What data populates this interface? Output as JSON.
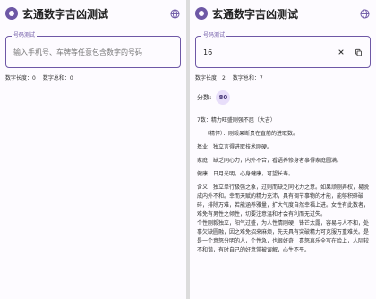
{
  "app": {
    "title": "玄通数字吉凶测试",
    "language_icon": "globe-icon"
  },
  "left": {
    "input": {
      "label": "号码测试",
      "value": "",
      "placeholder": "输入手机号、车牌等任意包含数字的号码"
    },
    "stats": {
      "length": "数字长度：0",
      "sum": "数字总和：0"
    }
  },
  "right": {
    "input": {
      "label": "号码测试",
      "value": "16"
    },
    "stats": {
      "length": "数字长度：2",
      "sum": "数字总和：7"
    },
    "score": {
      "label": "分数:",
      "value": "80"
    },
    "result": {
      "heading": "7数：精力旺盛刚强不屈（大吉）",
      "sub": "（精悍）：刚毅果断贵在直前的进取数。",
      "foundation": "基业：独立言得进取技术刚硬。",
      "family": "家庭：缺乏同心力，内外不合，看语养修身者事得家庭圆满。",
      "health": "健康：日月光明，心身健康，可望长寿。",
      "meaning_lines": [
        "含义：独立单行极强之象，过则而缺乏同化力之意。如果顽刚弄权，易脱",
        "成内外不和。幸而天赋的精力充沛，具有调节事物的才能，能够积碎破",
        "碎，排除万难，若能涵养雅量，扩大气度自然幸福上进。女性有此数者，",
        "难免有男性之倾性，切要注意温和才会有利而无过失。",
        "个性刚毅独立，阳气过盛，为人性情刚硬，锋芒太露，容易与人不和，处",
        "事欠缺圆融，因之难免招来麻烦，先天具有突破精力可克服万重难关。是",
        "是一个意怒分明的人，个性急，也很好奇，喜怒哀乐全写在脸上，人际较",
        "不和谐，有时自己的好意常被误解，心生不平。"
      ]
    }
  }
}
